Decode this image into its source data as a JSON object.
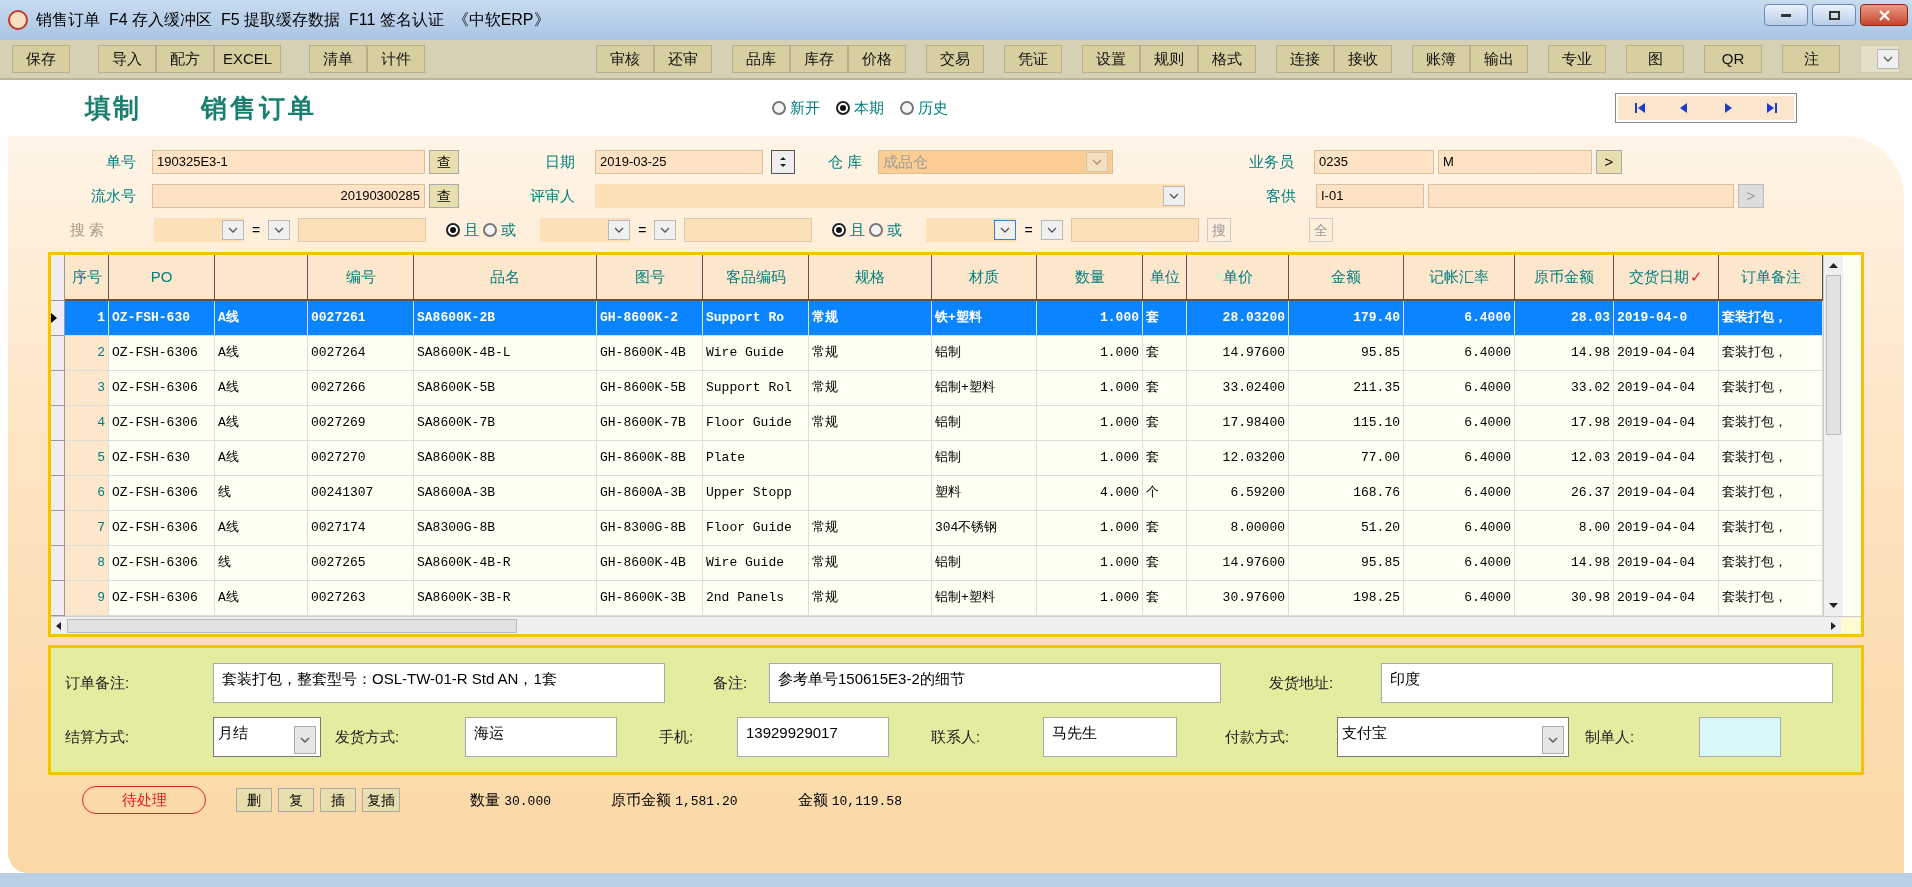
{
  "window": {
    "title": "销售订单  F4 存入缓冲区  F5 提取缓存数据  F11 签名认证  《中软ERP》"
  },
  "toolbar": {
    "left": [
      [
        "保存"
      ],
      [
        "导入",
        "配方",
        "EXCEL"
      ],
      [
        "清单",
        "计件"
      ]
    ],
    "right": [
      [
        "审核",
        "还审"
      ],
      [
        "品库",
        "库存",
        "价格"
      ],
      [
        "交易"
      ],
      [
        "凭证"
      ],
      [
        "设置",
        "规则",
        "格式"
      ],
      [
        "连接",
        "接收"
      ],
      [
        "账簿",
        "输出"
      ],
      [
        "专业"
      ],
      [
        "图"
      ],
      [
        "QR"
      ],
      [
        "注"
      ]
    ]
  },
  "heading": [
    "填制",
    "销售订单"
  ],
  "period_options": [
    {
      "label": "新开",
      "selected": false
    },
    {
      "label": "本期",
      "selected": true
    },
    {
      "label": "历史",
      "selected": false
    }
  ],
  "header": {
    "order_no": {
      "label": "单号",
      "value": "190325E3-1",
      "button": "查"
    },
    "serial_no": {
      "label": "流水号",
      "value": "20190300285",
      "button": "查"
    },
    "date": {
      "label": "日期",
      "value": "2019-03-25"
    },
    "reviewer": {
      "label": "评审人"
    },
    "warehouse": {
      "label": "仓 库",
      "value": "成品仓",
      "disabled": true
    },
    "salesperson": {
      "label": "业务员",
      "code": "0235",
      "name": "M",
      "button": ">"
    },
    "customer": {
      "label": "客供",
      "code": "I-01",
      "button": ">",
      "disabled": true
    }
  },
  "search": {
    "label": "搜 索",
    "conditions": [
      {
        "eq": "=",
        "focused": false,
        "logic": [
          {
            "label": "且",
            "selected": true
          },
          {
            "label": "或",
            "selected": false
          }
        ]
      },
      {
        "eq": "=",
        "focused": false,
        "logic": [
          {
            "label": "且",
            "selected": true
          },
          {
            "label": "或",
            "selected": false
          }
        ]
      },
      {
        "eq": "=",
        "focused": true
      }
    ],
    "search_button": "搜",
    "all_button": "全"
  },
  "table": {
    "columns": [
      {
        "label": "序号"
      },
      {
        "label": "PO"
      },
      {},
      {
        "label": "编号"
      },
      {
        "label": "品名"
      },
      {
        "label": "图号"
      },
      {
        "label": "客品编码"
      },
      {
        "label": "规格"
      },
      {
        "label": "材质"
      },
      {
        "label": "数量"
      },
      {
        "label": "单位"
      },
      {
        "label": "单价"
      },
      {
        "label": "金额"
      },
      {
        "label": "记帐汇率"
      },
      {
        "label": "原币金额"
      },
      {
        "label": "交货日期",
        "mark": "✓"
      },
      {
        "label": "订单备注"
      }
    ],
    "rows": [
      {
        "selected": true,
        "cells": [
          "1",
          "OZ-FSH-630",
          "A线",
          "0027261",
          "SA8600K-2B",
          "GH-8600K-2",
          "Support Ro",
          "常规",
          "铁+塑料",
          "1.000",
          "套",
          "28.03200",
          "179.40",
          "6.4000",
          "28.03",
          "2019-04-0",
          "套装打包，"
        ]
      },
      {
        "selected": false,
        "cells": [
          "2",
          "OZ-FSH-6306",
          "A线",
          "0027264",
          "SA8600K-4B-L",
          "GH-8600K-4B",
          "Wire Guide",
          "常规",
          "铝制",
          "1.000",
          "套",
          "14.97600",
          "95.85",
          "6.4000",
          "14.98",
          "2019-04-04",
          "套装打包，"
        ]
      },
      {
        "selected": false,
        "cells": [
          "3",
          "OZ-FSH-6306",
          "A线",
          "0027266",
          "SA8600K-5B",
          "GH-8600K-5B",
          "Support Rol",
          "常规",
          "铝制+塑料",
          "1.000",
          "套",
          "33.02400",
          "211.35",
          "6.4000",
          "33.02",
          "2019-04-04",
          "套装打包，"
        ]
      },
      {
        "selected": false,
        "cells": [
          "4",
          "OZ-FSH-6306",
          "A线",
          "0027269",
          "SA8600K-7B",
          "GH-8600K-7B",
          "Floor Guide",
          "常规",
          "铝制",
          "1.000",
          "套",
          "17.98400",
          "115.10",
          "6.4000",
          "17.98",
          "2019-04-04",
          "套装打包，"
        ]
      },
      {
        "selected": false,
        "cells": [
          "5",
          "OZ-FSH-630",
          "A线",
          "0027270",
          "SA8600K-8B",
          "GH-8600K-8B",
          "Plate",
          null,
          "铝制",
          "1.000",
          "套",
          "12.03200",
          "77.00",
          "6.4000",
          "12.03",
          "2019-04-04",
          "套装打包，"
        ]
      },
      {
        "selected": false,
        "cells": [
          "6",
          "OZ-FSH-6306",
          "线",
          "00241307",
          "SA8600A-3B",
          "GH-8600A-3B",
          "Upper Stopp",
          null,
          "塑料",
          "4.000",
          "个",
          "6.59200",
          "168.76",
          "6.4000",
          "26.37",
          "2019-04-04",
          "套装打包，"
        ]
      },
      {
        "selected": false,
        "cells": [
          "7",
          "OZ-FSH-6306",
          "A线",
          "0027174",
          "SA8300G-8B",
          "GH-8300G-8B",
          "Floor Guide",
          "常规",
          "304不锈钢",
          "1.000",
          "套",
          "8.00000",
          "51.20",
          "6.4000",
          "8.00",
          "2019-04-04",
          "套装打包，"
        ]
      },
      {
        "selected": false,
        "cells": [
          "8",
          "OZ-FSH-6306",
          "线",
          "0027265",
          "SA8600K-4B-R",
          "GH-8600K-4B",
          "Wire Guide",
          "常规",
          "铝制",
          "1.000",
          "套",
          "14.97600",
          "95.85",
          "6.4000",
          "14.98",
          "2019-04-04",
          "套装打包，"
        ]
      },
      {
        "selected": false,
        "cells": [
          "9",
          "OZ-FSH-6306",
          "A线",
          "0027263",
          "SA8600K-3B-R",
          "GH-8600K-3B",
          "2nd Panels",
          "常规",
          "铝制+塑料",
          "1.000",
          "套",
          "30.97600",
          "198.25",
          "6.4000",
          "30.98",
          "2019-04-04",
          "套装打包，"
        ]
      }
    ]
  },
  "details": [
    [
      {
        "label": "订单备注:",
        "value": "套装打包，整套型号：OSL-TW-01-R Std AN，1套",
        "kind": "text"
      },
      {
        "label": "备注:",
        "value": "参考单号150615E3-2的细节",
        "kind": "text"
      },
      {
        "label": "发货地址:",
        "value": "印度",
        "kind": "text"
      }
    ],
    [
      {
        "label": "结算方式:",
        "value": "月结",
        "kind": "select"
      },
      {
        "label": "发货方式:",
        "value": "海运",
        "kind": "text"
      },
      {
        "label": "手机:",
        "value": "13929929017",
        "kind": "text"
      },
      {
        "label": "联系人:",
        "value": "马先生",
        "kind": "text"
      },
      {
        "label": "付款方式:",
        "value": "支付宝",
        "kind": "select"
      },
      {
        "label": "制单人:",
        "kind": "readonly"
      }
    ]
  ],
  "footer": {
    "status": "待处理",
    "buttons": [
      "删",
      "复",
      "插",
      "复插"
    ],
    "totals": [
      {
        "label": "数量",
        "value": "30.000"
      },
      {
        "label": "原币金额",
        "value": "1,581.20"
      },
      {
        "label": "金额",
        "value": "10,119.58"
      }
    ]
  }
}
